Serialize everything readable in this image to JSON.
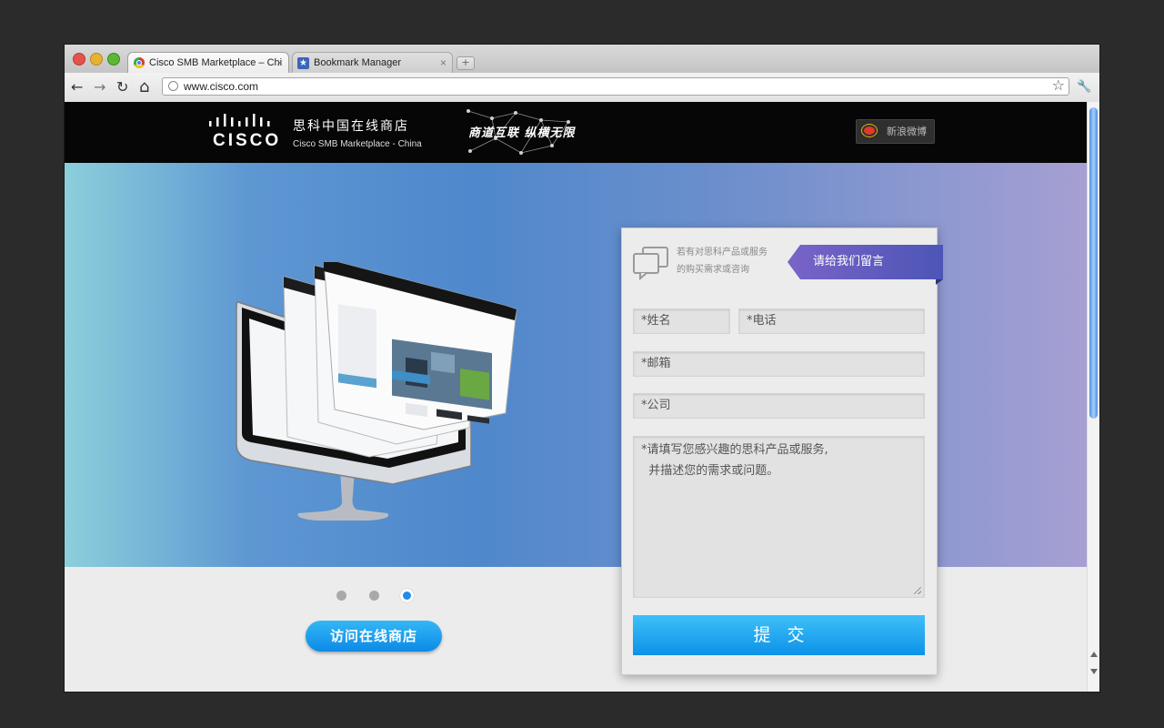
{
  "browser": {
    "tabs": [
      {
        "title": "Cisco SMB Marketplace – Chi",
        "close": "×"
      },
      {
        "title": "Bookmark Manager",
        "close": "×"
      }
    ],
    "new_tab": "+",
    "url": "www.cisco.com",
    "back": "←",
    "forward": "→",
    "reload": "↻",
    "home": "⌂",
    "star": "☆",
    "wrench": "🔧"
  },
  "header": {
    "logo_text": "CISCO",
    "cn_title": "思科中国在线商店",
    "en_subtitle": "Cisco SMB Marketplace - China",
    "slogan": "商道互联 纵横无限",
    "weibo_label": "新浪微博"
  },
  "hero": {
    "dots_count": 3,
    "active_dot": 3,
    "cta_label": "访问在线商店"
  },
  "form": {
    "intro_line1": "若有对思科产品或服务",
    "intro_line2": "的购买需求或咨询",
    "ribbon_label": "请给我们留言",
    "name_placeholder": "*姓名",
    "phone_placeholder": "*电话",
    "email_placeholder": "*邮箱",
    "company_placeholder": "*公司",
    "message_line1": "*请填写您感兴趣的思科产品或服务,",
    "message_line2": "  并描述您的需求或问题。",
    "submit_label": "提   交"
  },
  "colors": {
    "accent": "#1aa8f0",
    "ribbon": "#5a58b8",
    "header_bg": "#060606"
  }
}
